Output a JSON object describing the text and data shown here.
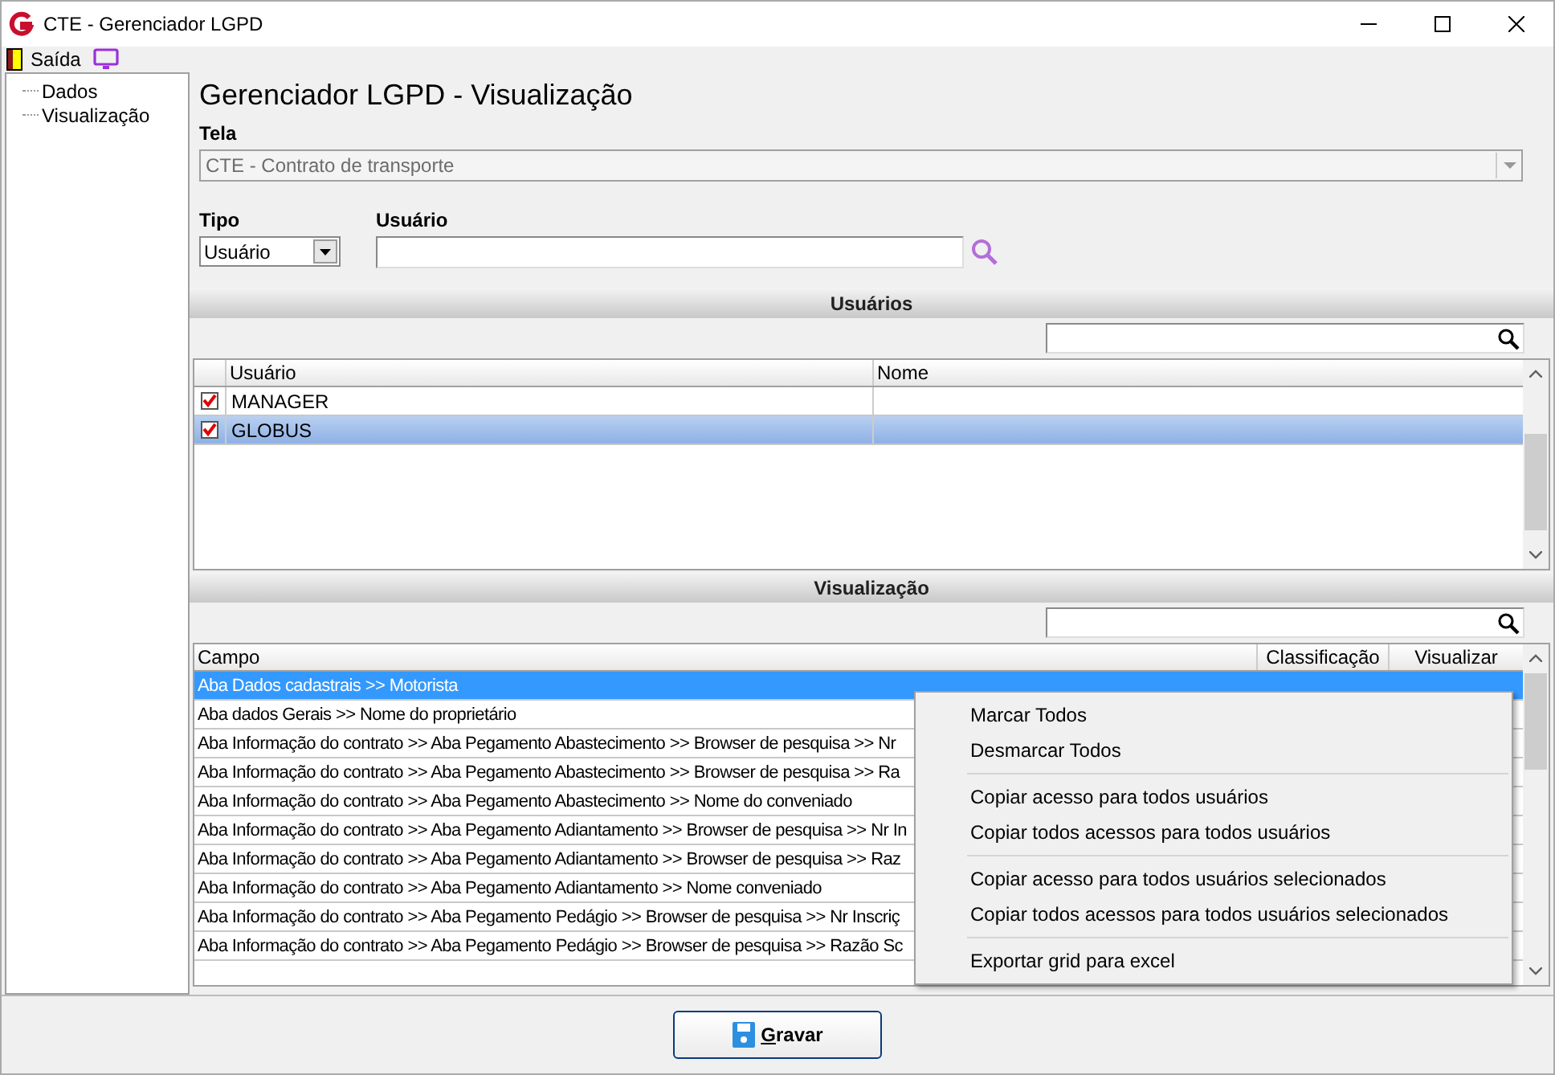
{
  "window": {
    "title": "CTE - Gerenciador LGPD"
  },
  "toolbar": {
    "exit_label": "Saída"
  },
  "tree": {
    "items": [
      {
        "label": "Dados",
        "selected": false
      },
      {
        "label": "Visualização",
        "selected": false
      }
    ]
  },
  "heading": "Gerenciador LGPD - Visualização",
  "tela": {
    "label": "Tela",
    "value": "CTE - Contrato de transporte",
    "disabled": true
  },
  "tipo": {
    "label": "Tipo",
    "value": "Usuário"
  },
  "usuario": {
    "label": "Usuário"
  },
  "users_section": {
    "title": "Usuários",
    "columns": [
      "Usuário",
      "Nome"
    ],
    "rows": [
      {
        "usuario": "MANAGER",
        "checked": true,
        "selected": false
      },
      {
        "usuario": "GLOBUS",
        "checked": true,
        "selected": true
      }
    ]
  },
  "view_section": {
    "title": "Visualização",
    "columns": [
      "Campo",
      "Classificação",
      "Visualizar"
    ],
    "rows": [
      {
        "campo": "Aba Dados cadastrais >> Motorista",
        "selected": true
      },
      {
        "campo": "Aba dados Gerais >> Nome do proprietário",
        "selected": false
      },
      {
        "campo": "Aba Informação do contrato >> Aba Pegamento Abastecimento >> Browser de pesquisa >> Nr",
        "selected": false
      },
      {
        "campo": "Aba Informação do contrato >> Aba Pegamento Abastecimento >> Browser de pesquisa >> Ra",
        "selected": false
      },
      {
        "campo": "Aba Informação do contrato >> Aba Pegamento Abastecimento >> Nome do conveniado",
        "selected": false
      },
      {
        "campo": "Aba Informação do contrato >> Aba Pegamento Adiantamento >> Browser de pesquisa >> Nr In",
        "selected": false
      },
      {
        "campo": "Aba Informação do contrato >> Aba Pegamento Adiantamento >> Browser de pesquisa >> Raz",
        "selected": false
      },
      {
        "campo": "Aba Informação do contrato >> Aba Pegamento Adiantamento >> Nome conveniado",
        "selected": false
      },
      {
        "campo": "Aba Informação do contrato >> Aba Pegamento Pedágio >> Browser de pesquisa >> Nr Inscriç",
        "selected": false
      },
      {
        "campo": "Aba Informação do contrato >> Aba Pegamento Pedágio >> Browser de pesquisa >> Razão Sc",
        "selected": false
      }
    ]
  },
  "context_menu": {
    "groups": [
      [
        "Marcar Todos",
        "Desmarcar Todos"
      ],
      [
        "Copiar acesso para todos usuários",
        "Copiar todos acessos para todos usuários"
      ],
      [
        "Copiar acesso para todos usuários selecionados",
        "Copiar todos acessos para todos usuários selecionados"
      ],
      [
        "Exportar grid para excel"
      ]
    ]
  },
  "save_button": {
    "label": "Gravar"
  }
}
